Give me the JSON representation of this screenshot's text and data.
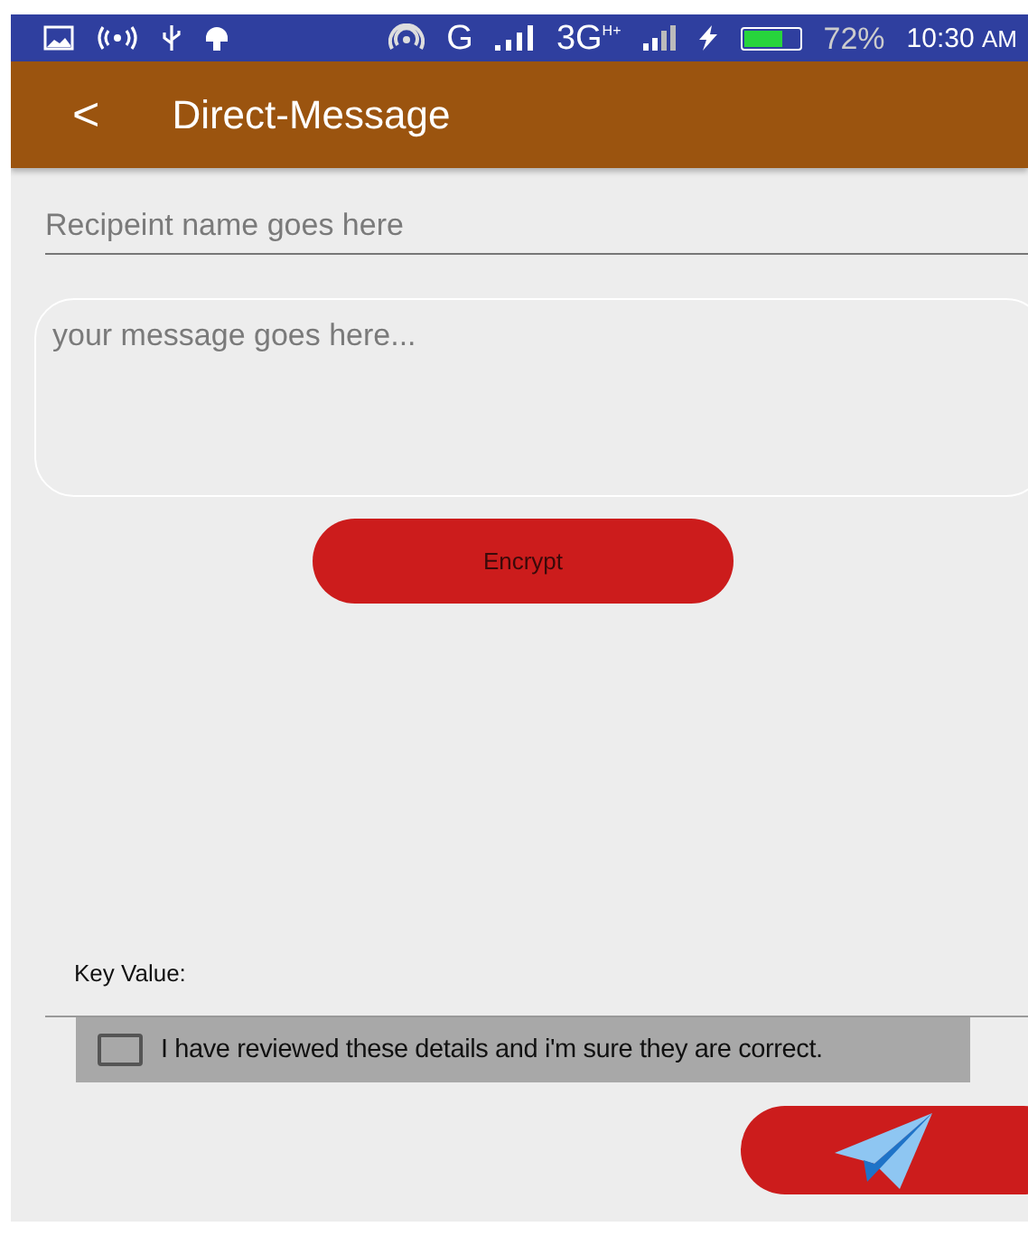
{
  "status_bar": {
    "network": "G",
    "network_2": "3G",
    "network_2_badge": "H+",
    "battery": {
      "level": 0.72,
      "label": "72%"
    },
    "time": "10:30",
    "time_suffix": "AM"
  },
  "app_bar": {
    "back": "<",
    "title": "Direct-Message"
  },
  "recipient": {
    "placeholder": "Recipeint name goes here"
  },
  "message": {
    "placeholder": "your message goes here..."
  },
  "encrypt_button": "Encrypt",
  "key_label": "Key Value:",
  "confirm": {
    "label": "I have reviewed these details and i'm sure they are correct.",
    "checked": false
  }
}
